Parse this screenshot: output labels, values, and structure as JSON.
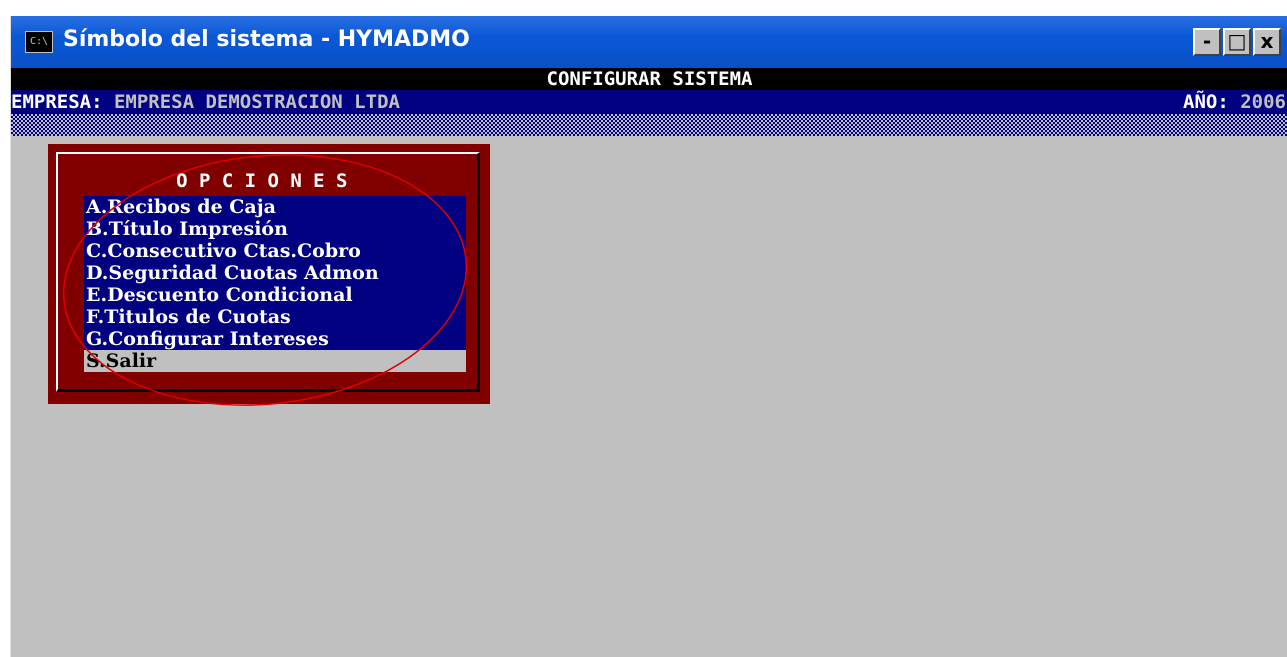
{
  "window": {
    "title": "Símbolo del sistema - HYMADMO",
    "icon_text": "C:\\",
    "controls": {
      "minimize": "-",
      "maximize": "□",
      "close": "x"
    }
  },
  "console": {
    "screen_title": "CONFIGURAR SISTEMA",
    "company_label": "EMPRESA:",
    "company_value": "EMPRESA DEMOSTRACION LTDA",
    "year_label": "AÑO:",
    "year_value": "2006"
  },
  "menu": {
    "title": "OPCIONES",
    "items": [
      "A.Recibos de Caja",
      "B.Título Impresión",
      "C.Consecutivo Ctas.Cobro",
      "D.Seguridad Cuotas Admon",
      "E.Descuento Condicional",
      "F.Titulos de Cuotas",
      "G.Configurar Intereses",
      "S.Salir"
    ],
    "selected_index": 7
  },
  "colors": {
    "console_bg": "#c0c0c0",
    "header_bar": "#000080",
    "menu_frame": "#800000",
    "menu_list": "#000080",
    "annotation": "#e00000"
  }
}
